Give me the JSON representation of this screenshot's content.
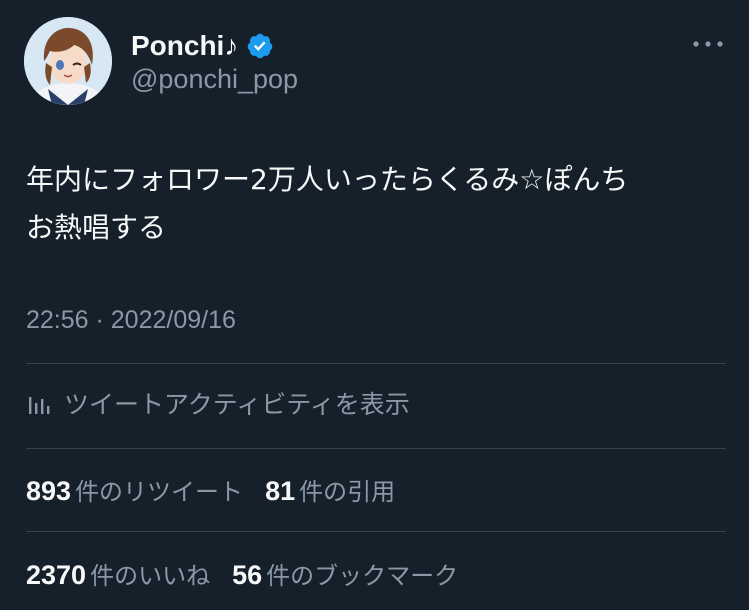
{
  "author": {
    "display_name": "Ponchi♪",
    "handle": "@ponchi_pop",
    "verified": true,
    "avatar_icon": "avatar-anime-character"
  },
  "tweet": {
    "text_line1": "年内にフォロワー2万人いったらくるみ☆ぽんち",
    "text_line2": "お熱唱する",
    "timestamp": "22:56 · 2022/09/16"
  },
  "activity": {
    "icon": "bar-chart-icon",
    "label": "ツイートアクティビティを表示"
  },
  "stats": {
    "retweets": {
      "count": "893",
      "label": "件のリツイート"
    },
    "quotes": {
      "count": "81",
      "label": "件の引用"
    },
    "likes": {
      "count": "2370",
      "label": "件のいいね"
    },
    "bookmarks": {
      "count": "56",
      "label": "件のブックマーク"
    }
  },
  "colors": {
    "background": "#15202b",
    "text_primary": "#f7f9f9",
    "text_secondary": "#8b98a5",
    "divider": "#38444d",
    "verified_blue": "#1d9bf0"
  }
}
